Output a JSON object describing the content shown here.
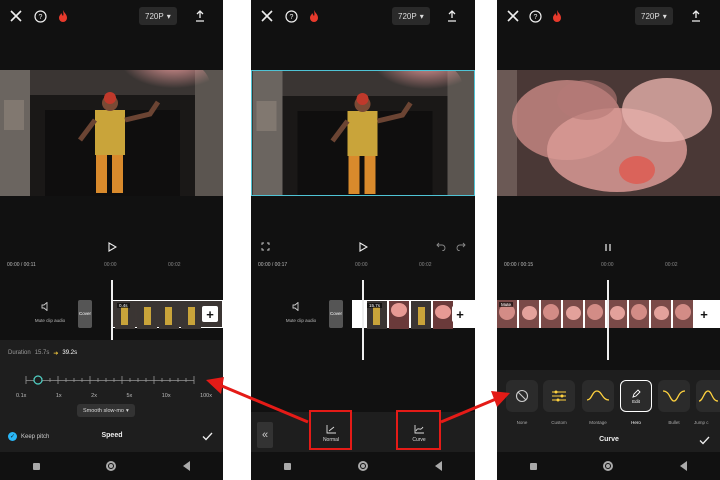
{
  "screens": [
    {
      "resolution": "720P",
      "timecode": "00:00 / 00:11",
      "ticks": [
        "00:00",
        "00:02"
      ],
      "mute_label": "Mute clip audio",
      "cover_label": "Cover",
      "clip_badge": "0.4s",
      "duration_label": "Duration",
      "duration_from": "15.7s",
      "duration_to": "39.2s",
      "speed_ticks": [
        "0.1x",
        "1x",
        "2x",
        "5x",
        "10x",
        "100x"
      ],
      "smooth_label": "Smooth slow-mo",
      "keep_pitch": "Keep pitch",
      "panel_title": "Speed"
    },
    {
      "resolution": "720P",
      "timecode": "00:00 / 00:17",
      "ticks": [
        "00:00",
        "00:02"
      ],
      "mute_label": "Mute clip audio",
      "cover_label": "Cover",
      "clip_badge": "15.7s",
      "normal_label": "Normal",
      "curve_label": "Curve"
    },
    {
      "resolution": "720P",
      "timecode": "00:00 / 00:15",
      "ticks": [
        "00:00",
        "00:02"
      ],
      "clip_badge": "Mute",
      "presets": [
        "None",
        "Custom",
        "Montage",
        "Hero",
        "Bullet",
        "Jump c"
      ],
      "edit_label": "Edit",
      "panel_title": "Curve"
    }
  ],
  "colors": {
    "highlight": "#e41b17",
    "accent": "#ffd23f",
    "check": "#29b6f6"
  }
}
